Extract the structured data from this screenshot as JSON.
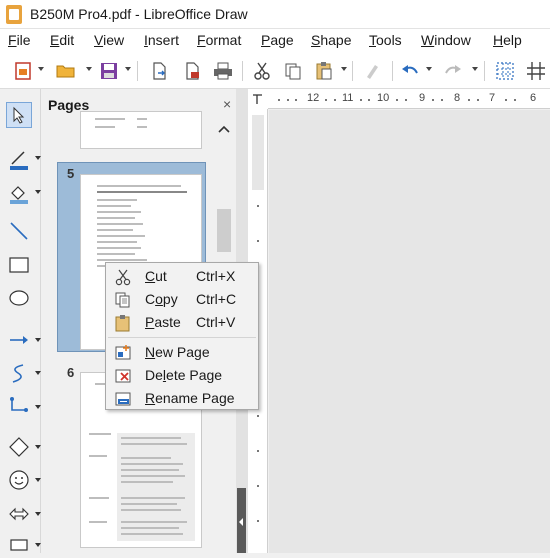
{
  "window": {
    "title": "B250M Pro4.pdf - LibreOffice Draw"
  },
  "menubar": {
    "items": [
      {
        "label": "File",
        "accel": "F",
        "rest": "ile"
      },
      {
        "label": "Edit",
        "accel": "E",
        "rest": "dit"
      },
      {
        "label": "View",
        "accel": "V",
        "rest": "iew"
      },
      {
        "label": "Insert",
        "accel": "I",
        "rest": "nsert"
      },
      {
        "label": "Format",
        "accel": "F",
        "rest": "ormat"
      },
      {
        "label": "Page",
        "accel": "P",
        "rest": "age"
      },
      {
        "label": "Shape",
        "accel": "S",
        "rest": "hape"
      },
      {
        "label": "Tools",
        "accel": "T",
        "rest": "ools"
      },
      {
        "label": "Window",
        "accel": "W",
        "rest": "indow"
      },
      {
        "label": "Help",
        "accel": "H",
        "rest": "elp"
      }
    ]
  },
  "pages_panel": {
    "title": "Pages",
    "close": "×",
    "page_numbers": [
      "5",
      "6"
    ]
  },
  "ruler": {
    "marks": [
      "12",
      "11",
      "10",
      "9",
      "8",
      "7",
      "6"
    ]
  },
  "context_menu": {
    "items": [
      {
        "pre": "",
        "accel": "C",
        "post": "ut",
        "shortcut": "Ctrl+X",
        "icon": "scissors-icon"
      },
      {
        "pre": "C",
        "accel": "o",
        "post": "py",
        "shortcut": "Ctrl+C",
        "icon": "copy-icon"
      },
      {
        "pre": "",
        "accel": "P",
        "post": "aste",
        "shortcut": "Ctrl+V",
        "icon": "paste-icon"
      },
      {
        "pre": "",
        "accel": "N",
        "post": "ew Page",
        "shortcut": "",
        "icon": "new-page-icon"
      },
      {
        "pre": "De",
        "accel": "l",
        "post": "ete Page",
        "shortcut": "",
        "icon": "delete-page-icon"
      },
      {
        "pre": "",
        "accel": "R",
        "post": "ename Page",
        "shortcut": "",
        "icon": "rename-page-icon"
      }
    ]
  },
  "colors": {
    "accent": "#3f77b8",
    "selected_thumb": "#9dbbd8"
  }
}
